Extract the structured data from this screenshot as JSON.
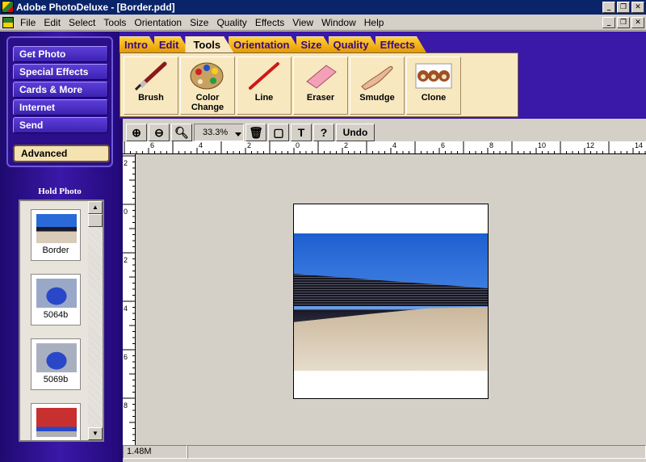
{
  "window": {
    "title": "Adobe PhotoDeluxe - [Border.pdd]"
  },
  "menubar": {
    "items": [
      "File",
      "Edit",
      "Select",
      "Tools",
      "Orientation",
      "Size",
      "Quality",
      "Effects",
      "View",
      "Window",
      "Help"
    ]
  },
  "sidebar": {
    "buttons": [
      "Get Photo",
      "Special Effects",
      "Cards & More",
      "Internet",
      "Send"
    ],
    "advanced": "Advanced",
    "hold_photo_label": "Hold Photo",
    "thumbnails": [
      {
        "caption": "Border"
      },
      {
        "caption": "5064b"
      },
      {
        "caption": "5069b"
      },
      {
        "caption": ""
      }
    ]
  },
  "tabs": {
    "items": [
      "Intro",
      "Edit",
      "Tools",
      "Orientation",
      "Size",
      "Quality",
      "Effects"
    ],
    "active": "Tools"
  },
  "tools": {
    "items": [
      "Brush",
      "Color\nChange",
      "Line",
      "Eraser",
      "Smudge",
      "Clone"
    ]
  },
  "toolbar": {
    "zoom": "33.3%",
    "undo": "Undo"
  },
  "rulers": {
    "h": [
      "6",
      "4",
      "2",
      "0",
      "2",
      "4",
      "6",
      "8",
      "10",
      "12",
      "14"
    ],
    "v": [
      "2",
      "0",
      "2",
      "4",
      "6",
      "8"
    ]
  },
  "status": {
    "size": "1.48M"
  },
  "colors": {
    "sidebar": "#2a0e8a",
    "tab": "#ffcf3a",
    "panel": "#f8e8c0",
    "titlebar": "#0a246a"
  }
}
